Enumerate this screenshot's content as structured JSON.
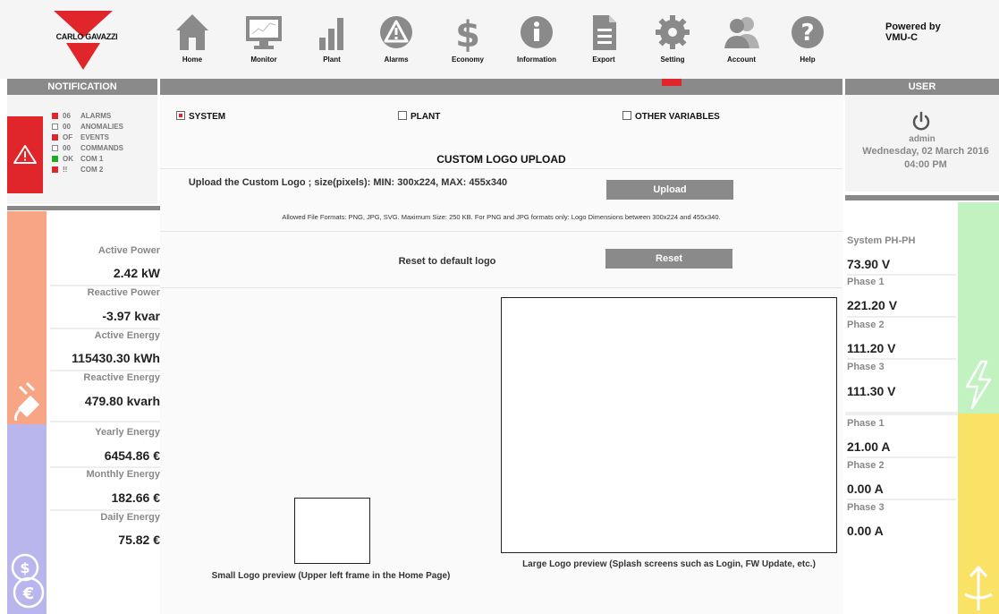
{
  "header": {
    "brand": "CARLO GAVAZZI",
    "powered_by": "Powered by",
    "product": "VMU-C",
    "nav": [
      {
        "label": "Home",
        "icon": "home-icon"
      },
      {
        "label": "Monitor",
        "icon": "monitor-icon"
      },
      {
        "label": "Plant",
        "icon": "plant-icon"
      },
      {
        "label": "Alarms",
        "icon": "alarm-icon"
      },
      {
        "label": "Economy",
        "icon": "dollar-icon"
      },
      {
        "label": "Information",
        "icon": "info-icon"
      },
      {
        "label": "Export",
        "icon": "export-icon"
      },
      {
        "label": "Setting",
        "icon": "gear-icon"
      },
      {
        "label": "Account",
        "icon": "account-icon"
      },
      {
        "label": "Help",
        "icon": "help-icon"
      }
    ]
  },
  "notification": {
    "title": "NOTIFICATION",
    "rows": [
      {
        "code": "06",
        "label": "ALARMS",
        "color": "#e1262b"
      },
      {
        "code": "00",
        "label": "ANOMALIES",
        "color": "#ffffff"
      },
      {
        "code": "OF",
        "label": "EVENTS",
        "color": "#e1262b"
      },
      {
        "code": "00",
        "label": "COMMANDS",
        "color": "#ffffff"
      },
      {
        "code": "OK",
        "label": "COM 1",
        "color": "#22aa22"
      },
      {
        "code": "!!",
        "label": "COM 2",
        "color": "#e1262b"
      }
    ]
  },
  "left_metrics": {
    "active_power_label": "Active Power",
    "active_power": "2.42 kW",
    "reactive_power_label": "Reactive Power",
    "reactive_power": "-3.97 kvar",
    "active_energy_label": "Active Energy",
    "active_energy": "115430.30 kWh",
    "reactive_energy_label": "Reactive Energy",
    "reactive_energy": "479.80 kvarh",
    "yearly_label": "Yearly Energy",
    "yearly": "6454.86 €",
    "monthly_label": "Monthly Energy",
    "monthly": "182.66 €",
    "daily_label": "Daily Energy",
    "daily": "75.82 €"
  },
  "main": {
    "checkboxes": [
      {
        "label": "SYSTEM",
        "checked": true
      },
      {
        "label": "PLANT",
        "checked": false
      },
      {
        "label": "OTHER VARIABLES",
        "checked": false
      }
    ],
    "title": "CUSTOM LOGO UPLOAD",
    "upload_desc": "Upload the Custom Logo ; size(pixels): MIN: 300x224, MAX: 455x340",
    "upload_button": "Upload",
    "allowed": "Allowed File Formats: PNG, JPG, SVG. Maximum Size: 250 KB. For PNG and JPG formats only: Logo Dimensions between 300x224 and 455x340.",
    "reset_label": "Reset to default logo",
    "reset_button": "Reset",
    "small_caption": "Small Logo preview (Upper left frame in the Home Page)",
    "large_caption": "Large Logo preview (Splash screens such as Login, FW Update, etc.)"
  },
  "user": {
    "title": "USER",
    "name": "admin",
    "date": "Wednesday, 02 March 2016",
    "time": "04:00 PM"
  },
  "right_metrics": {
    "sys_label": "System PH-PH",
    "sys_value": "73.90 V",
    "v1_label": "Phase 1",
    "v1": "221.20 V",
    "v2_label": "Phase 2",
    "v2": "111.20 V",
    "v3_label": "Phase 3",
    "v3": "111.30 V",
    "a1_label": "Phase 1",
    "a1": "21.00 A",
    "a2_label": "Phase 2",
    "a2": "0.00 A",
    "a3_label": "Phase 3",
    "a3": "0.00 A"
  },
  "colors": {
    "brand_red": "#e1262b",
    "bar_gray": "#8a8a8a",
    "power_orange": "#f7a584",
    "economy_purple": "#b9b6ee",
    "voltage_green": "#c2f2c0",
    "current_yellow": "#fae266"
  }
}
